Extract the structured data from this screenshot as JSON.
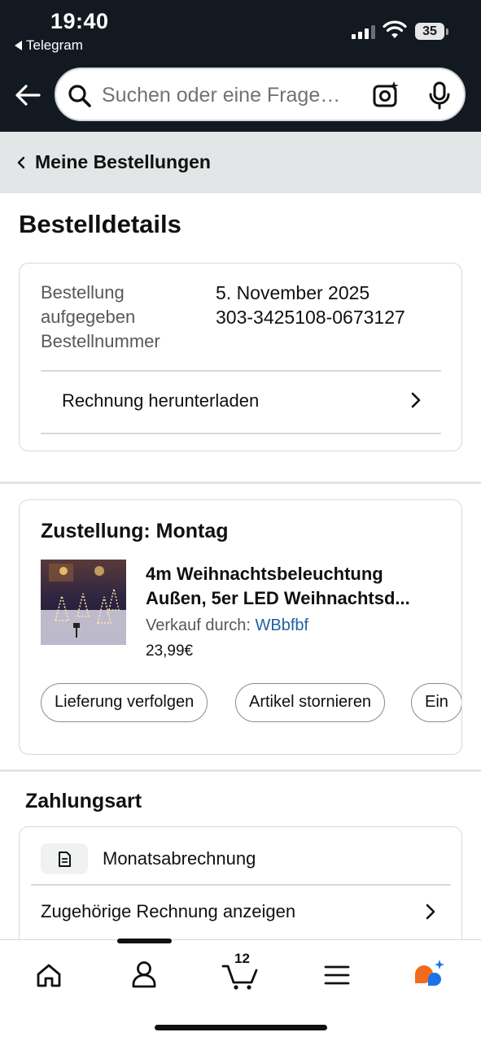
{
  "status_bar": {
    "time": "19:40",
    "back_app": "Telegram",
    "battery": "35"
  },
  "header": {
    "search_placeholder": "Suchen oder eine Frage…"
  },
  "breadcrumb": {
    "label": "Meine Bestellungen"
  },
  "page_title": "Bestelldetails",
  "order_info": {
    "placed_label": "Bestellung aufgegeben",
    "placed_label_line1": "Bestellung",
    "placed_label_line2": "aufgegeben",
    "number_label": "Bestellnummer",
    "placed_value": "5. November 2025",
    "number_value": "303-3425108-0673127",
    "invoice_link": "Rechnung herunterladen"
  },
  "delivery": {
    "title": "Zustellung: Montag",
    "product_title": "4m Weihnachtsbeleuchtung Außen, 5er LED Weihnachtsd...",
    "seller_prefix": "Verkauf durch: ",
    "seller_name": "WBbfbf",
    "price": "23,99€",
    "buttons": [
      "Lieferung verfolgen",
      "Artikel stornieren",
      "Ein"
    ]
  },
  "payment": {
    "section_title": "Zahlungsart",
    "method": "Monatsabrechnung",
    "invoice_link": "Zugehörige Rechnung anzeigen"
  },
  "bottom_nav": {
    "cart_count": "12",
    "items": [
      "home-icon",
      "account-icon",
      "cart-icon",
      "menu-icon",
      "rufus-ai-icon"
    ]
  },
  "colors": {
    "header_bg": "#131921",
    "link": "#2162a1",
    "breadcrumb_bg": "#e3e6e6",
    "text": "#0f1111",
    "secondary_text": "#565959"
  }
}
